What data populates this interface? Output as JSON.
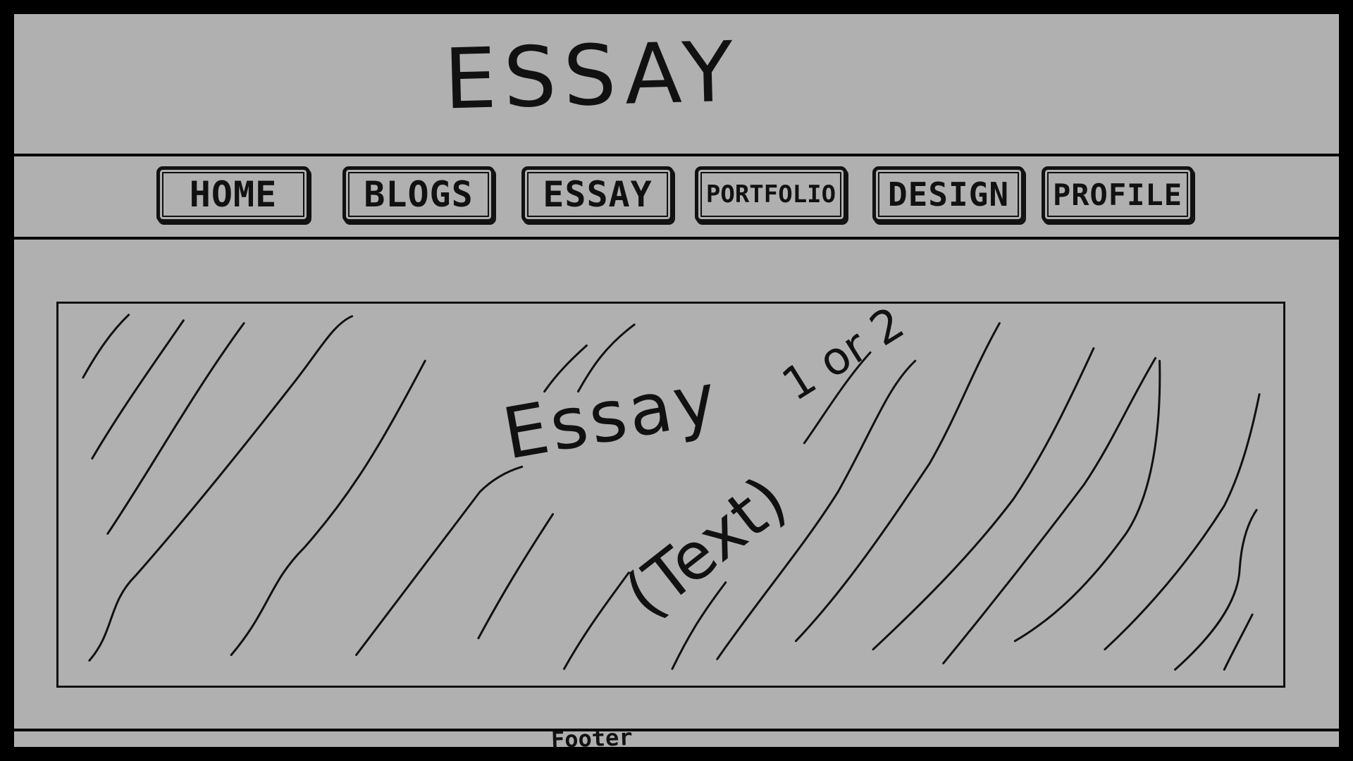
{
  "header": {
    "title": "ESSAY"
  },
  "nav": {
    "items": [
      {
        "label": "HOME"
      },
      {
        "label": "BLOGS"
      },
      {
        "label": "ESSAY"
      },
      {
        "label": "PORTFOLIO"
      },
      {
        "label": "DESIGN"
      },
      {
        "label": "PROFILE"
      }
    ]
  },
  "main": {
    "content_title": "Essay",
    "content_suffix": "1 or 2",
    "content_note": "(Text)"
  },
  "footer": {
    "label": "Footer"
  },
  "colors": {
    "page_background": "#b0b0b0",
    "border": "#000000",
    "ink": "#111111"
  }
}
